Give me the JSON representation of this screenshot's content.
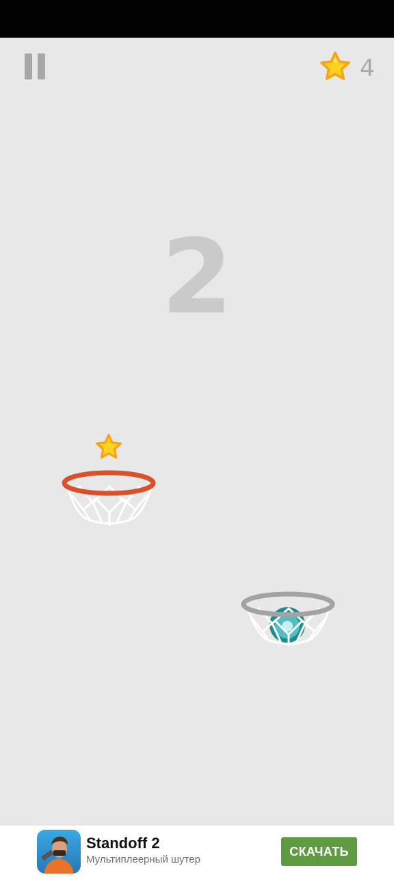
{
  "game": {
    "score": "2",
    "stars_collected": "4",
    "colors": {
      "background": "#e8e8e8",
      "active_hoop": "#d9512b",
      "inactive_hoop": "#a3a3a3",
      "net": "#ffffff",
      "ball": "#1f8c8c",
      "star": "#ffd21f",
      "score_text": "#cacaca"
    },
    "icons": [
      "pause-icon",
      "star-icon",
      "bonus-star-icon",
      "basketball-icon"
    ]
  },
  "ad": {
    "title": "Standoff 2",
    "subtitle": "Мультиплеерный шутер",
    "cta_label": "СКАЧАТЬ",
    "cta_color": "#5e9b41"
  }
}
